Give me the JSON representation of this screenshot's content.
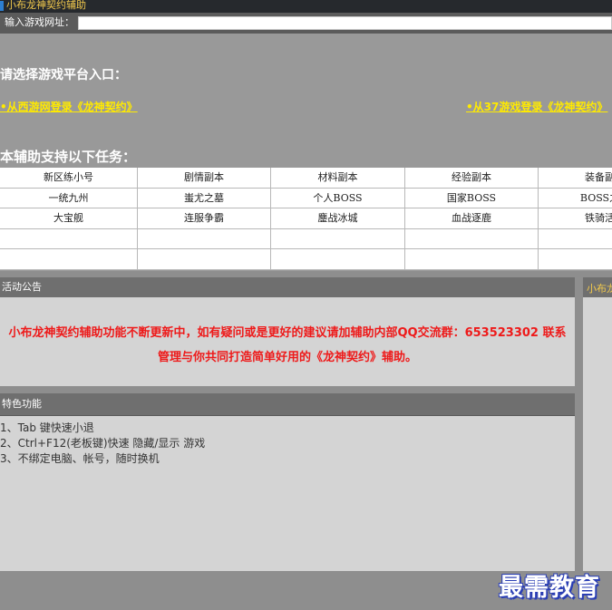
{
  "window": {
    "title": "小布龙神契约辅助"
  },
  "urlbar": {
    "label": "输入游戏网址：",
    "value": ""
  },
  "platform": {
    "heading": "请选择游戏平台入口：",
    "links": [
      "•从西游网登录《龙神契约》",
      "•从37游戏登录《龙神契约》"
    ]
  },
  "tasks": {
    "heading": "本辅助支持以下任务：",
    "rows": [
      [
        "新区练小号",
        "剧情副本",
        "材料副本",
        "经验副本",
        "装备副本"
      ],
      [
        "一统九州",
        "蚩尤之墓",
        "个人BOSS",
        "国家BOSS",
        "BOSS之家"
      ],
      [
        "大宝舰",
        "连服争霸",
        "鏖战冰城",
        "血战逐鹿",
        "铁骑活动"
      ],
      [
        "",
        "",
        "",
        "",
        ""
      ],
      [
        "",
        "",
        "",
        "",
        ""
      ]
    ]
  },
  "notice": {
    "title": "活动公告",
    "lines": [
      "小布龙神契约辅助功能不断更新中，如有疑问或是更好的建议请加辅助内部QQ交流群：653523302 联系",
      "管理与你共同打造简单好用的《龙神契约》辅助。"
    ],
    "color": "#ee1a1a"
  },
  "features": {
    "title": "特色功能",
    "items": [
      "1、Tab 键快速小退",
      "2、Ctrl+F12(老板键)快速 隐藏/显示 游戏",
      "3、不绑定电脑、帐号，随时换机"
    ]
  },
  "side_panel": {
    "title": "小布龙神"
  },
  "watermark": {
    "text": "最需教育"
  }
}
